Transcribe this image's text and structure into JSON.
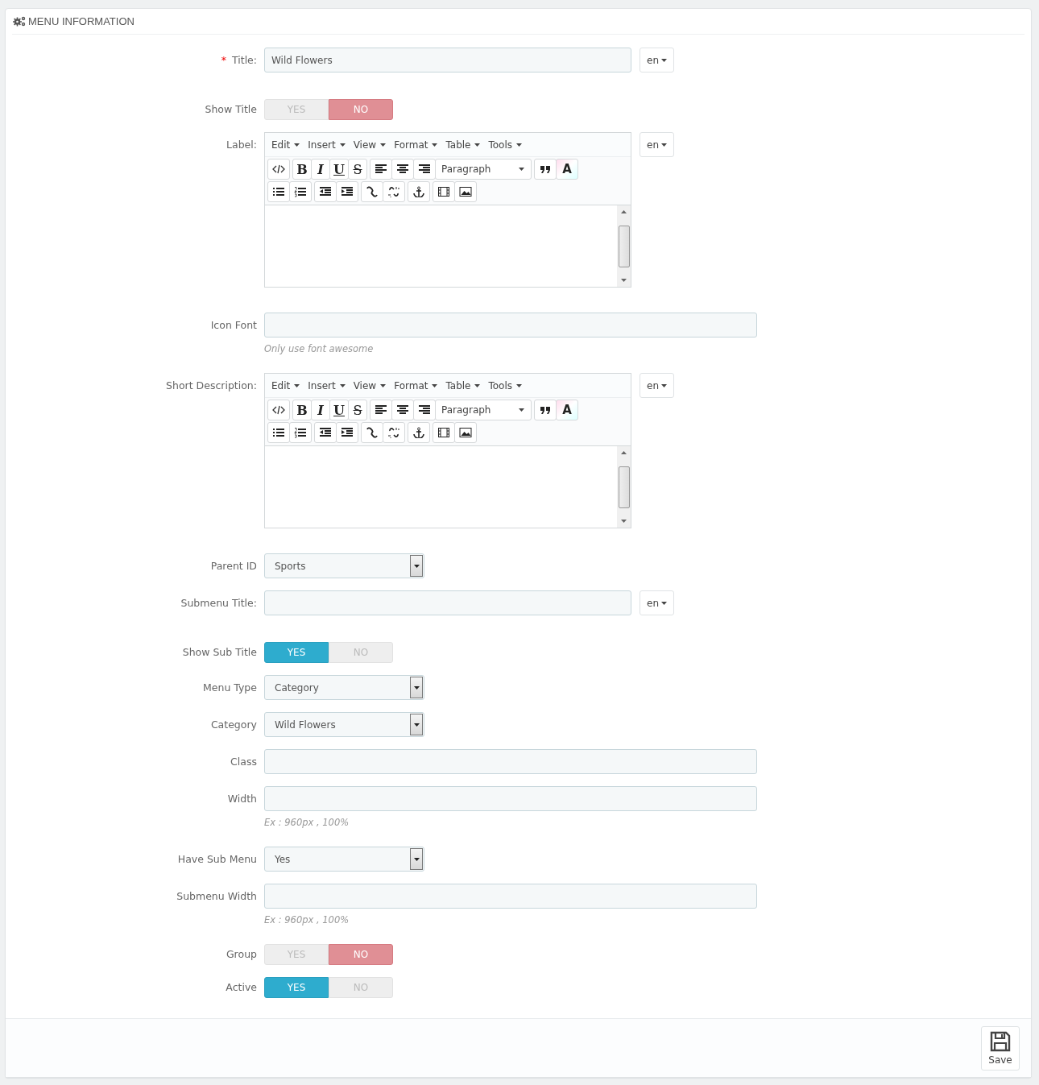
{
  "panel": {
    "heading": "MENU INFORMATION"
  },
  "fields": [
    {
      "kind": "text",
      "label": "Title:",
      "required_mark": "*",
      "value": "Wild Flowers",
      "lang": "en"
    },
    {
      "kind": "switch",
      "label": "Show Title",
      "options": [
        {
          "label": "YES",
          "selected": false
        },
        {
          "label": "NO",
          "selected": true
        }
      ]
    },
    {
      "kind": "editor",
      "label": "Label:",
      "lang": "en",
      "menus": [
        "Edit",
        "Insert",
        "View",
        "Format",
        "Table",
        "Tools"
      ],
      "style_buttons": [
        "B",
        "I",
        "U",
        "S"
      ],
      "block_format": "Paragraph",
      "color_button": "A"
    },
    {
      "kind": "input",
      "label": "Icon Font",
      "hint": "Only use font awesome"
    },
    {
      "kind": "editor",
      "label": "Short Description:",
      "lang": "en",
      "menus": [
        "Edit",
        "Insert",
        "View",
        "Format",
        "Table",
        "Tools"
      ],
      "style_buttons": [
        "B",
        "I",
        "U",
        "S"
      ],
      "block_format": "Paragraph",
      "color_button": "A"
    },
    {
      "kind": "select",
      "label": "Parent ID",
      "value": "Sports"
    },
    {
      "kind": "text",
      "label": "Submenu Title:",
      "lang": "en"
    },
    {
      "kind": "switch",
      "label": "Show Sub Title",
      "options": [
        {
          "label": "YES",
          "selected": true
        },
        {
          "label": "NO",
          "selected": false
        }
      ]
    },
    {
      "kind": "select",
      "label": "Menu Type",
      "value": "Category"
    },
    {
      "kind": "select",
      "label": "Category",
      "value": "Wild Flowers"
    },
    {
      "kind": "input",
      "label": "Class"
    },
    {
      "kind": "input",
      "label": "Width",
      "hint": "Ex : 960px , 100%"
    },
    {
      "kind": "select",
      "label": "Have Sub Menu",
      "value": "Yes"
    },
    {
      "kind": "input",
      "label": "Submenu Width",
      "hint": "Ex : 960px , 100%"
    },
    {
      "kind": "switch",
      "label": "Group",
      "options": [
        {
          "label": "YES",
          "selected": false
        },
        {
          "label": "NO",
          "selected": true
        }
      ]
    },
    {
      "kind": "switch",
      "label": "Active",
      "options": [
        {
          "label": "YES",
          "selected": true
        },
        {
          "label": "NO",
          "selected": false
        }
      ]
    }
  ],
  "footer": {
    "save_button": "Save"
  }
}
